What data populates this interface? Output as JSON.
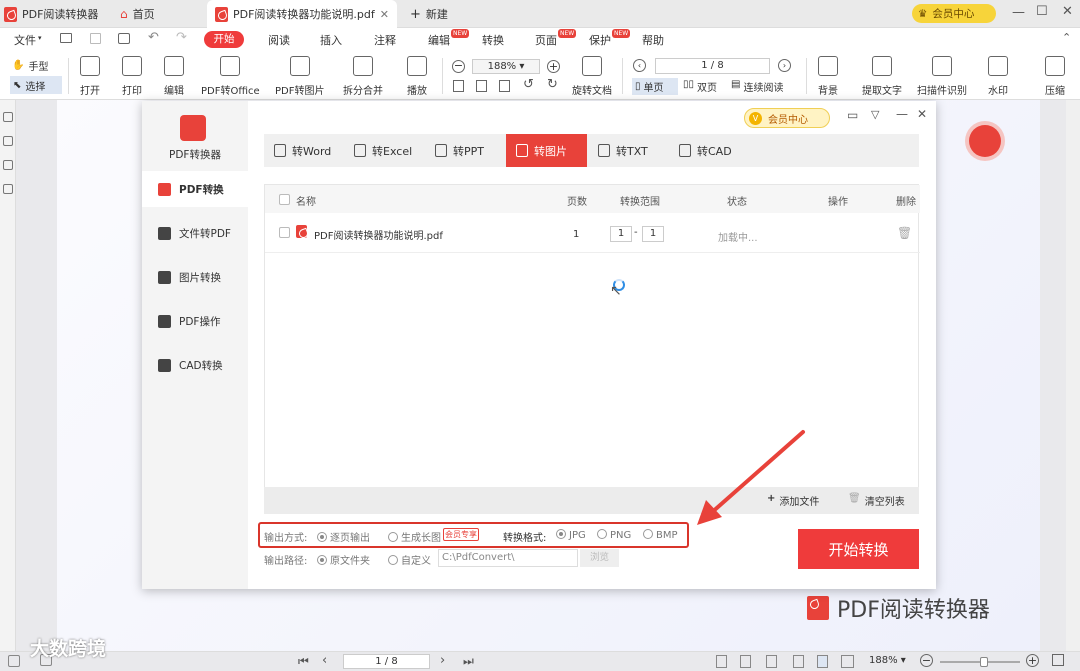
{
  "titlebar": {
    "app_tab": "PDF阅读转换器",
    "home_tab": "首页",
    "doc_tab": "PDF阅读转换器功能说明.pdf",
    "new_tab": "新建",
    "vip": "会员中心"
  },
  "menubar": {
    "file": "文件",
    "start": "开始",
    "items": [
      "阅读",
      "插入",
      "注释",
      "编辑",
      "转换",
      "页面",
      "保护",
      "帮助"
    ],
    "new_badge": "NEW"
  },
  "ribbon": {
    "hand": "手型",
    "select": "选择",
    "open": "打开",
    "print": "打印",
    "edit": "编辑",
    "to_office": "PDF转Office",
    "to_image": "PDF转图片",
    "split_merge": "拆分合并",
    "play": "播放",
    "zoom": "188%",
    "rotate": "旋转文档",
    "page": "1 / 8",
    "single": "单页",
    "double": "双页",
    "continuous": "连续阅读",
    "background": "背景",
    "extract_text": "提取文字",
    "scan_ocr": "扫描件识别",
    "watermark": "水印",
    "compress": "压缩"
  },
  "dialog": {
    "app_name": "PDF转换器",
    "vip": "会员中心",
    "sidebar": [
      "PDF转换",
      "文件转PDF",
      "图片转换",
      "PDF操作",
      "CAD转换"
    ],
    "tabs": [
      "转Word",
      "转Excel",
      "转PPT",
      "转图片",
      "转TXT",
      "转CAD"
    ],
    "table": {
      "headers": {
        "name": "名称",
        "pages": "页数",
        "range": "转换范围",
        "status": "状态",
        "action": "操作",
        "delete": "删除"
      },
      "rows": [
        {
          "name": "PDF阅读转换器功能说明.pdf",
          "pages": "1",
          "from": "1",
          "to": "1",
          "status": "加载中..."
        }
      ]
    },
    "add_file": "添加文件",
    "clear_list": "清空列表",
    "output_mode_label": "输出方式:",
    "output_mode_options": [
      "逐页输出",
      "生成长图"
    ],
    "vip_badge": "会员专享",
    "format_label": "转换格式:",
    "format_options": [
      "JPG",
      "PNG",
      "BMP"
    ],
    "output_path_label": "输出路径:",
    "path_options": [
      "原文件夹",
      "自定义"
    ],
    "path_value": "C:\\PdfConvert\\",
    "browse": "浏览",
    "start_button": "开始转换"
  },
  "watermark_brand": "PDF阅读转换器",
  "corner_logo": "大数跨境",
  "statusbar": {
    "page": "1 / 8",
    "zoom": "188%"
  },
  "colors": {
    "accent": "#e8423a",
    "start": "#ef3b3b",
    "highlight_box": "#d9352b"
  }
}
